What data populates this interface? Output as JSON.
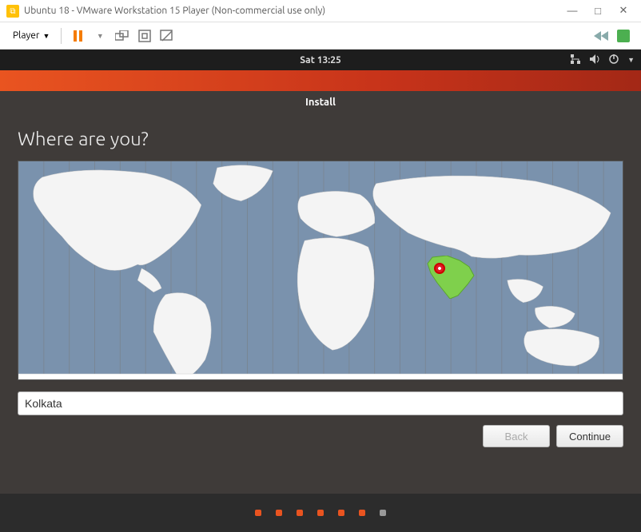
{
  "window": {
    "title": "Ubuntu 18 - VMware Workstation 15 Player (Non-commercial use only)"
  },
  "vmware_toolbar": {
    "player_menu_label": "Player"
  },
  "ubuntu_top_bar": {
    "clock": "Sat 13:25"
  },
  "installer": {
    "title": "Install",
    "heading": "Where are you?",
    "location_value": "Kolkata",
    "back_button": "Back",
    "continue_button": "Continue"
  },
  "pager": {
    "total": 7,
    "current_index": 5
  }
}
